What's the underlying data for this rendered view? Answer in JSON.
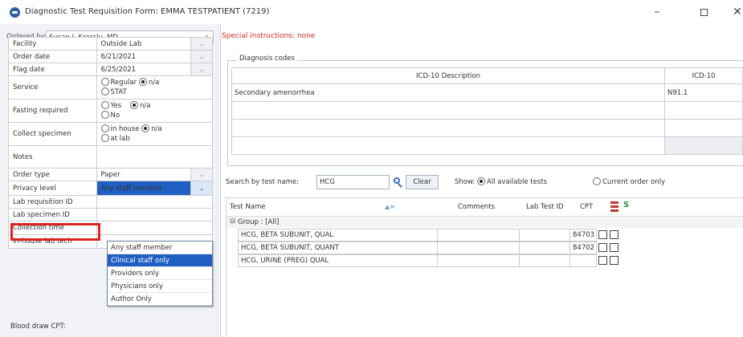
{
  "window": {
    "title": "Diagnostic Test Requisition Form: EMMA TESTPATIENT (7219)",
    "minimize": "–",
    "close": "✕"
  },
  "ordered_by": {
    "label": "Ordered by:",
    "value": "Susan J. Kressly, MD"
  },
  "fields": {
    "facility": {
      "label": "Facility",
      "value": "Outside Lab"
    },
    "order_date": {
      "label": "Order date",
      "value": "6/21/2021"
    },
    "flag_date": {
      "label": "Flag date",
      "value": "6/25/2021"
    },
    "service": {
      "label": "Service",
      "opt1": "Regular",
      "opt2": "n/a",
      "opt3": "STAT",
      "selected": "n/a"
    },
    "fasting": {
      "label": "Fasting required",
      "opt1": "Yes",
      "opt2": "n/a",
      "opt3": "No",
      "selected": "n/a"
    },
    "collect": {
      "label": "Collect specimen",
      "opt1": "in house",
      "opt2": "n/a",
      "opt3": "at lab",
      "selected": "n/a"
    },
    "notes": {
      "label": "Notes",
      "value": ""
    },
    "order_type": {
      "label": "Order type",
      "value": "Paper"
    },
    "privacy": {
      "label": "Privacy level",
      "value": "Any staff member"
    },
    "lab_req": {
      "label": "Lab requisition ID"
    },
    "lab_spec": {
      "label": "Lab specimen ID"
    },
    "collection_time": {
      "label": "Collection time"
    },
    "inhouse_tech": {
      "label": "In-house lab tech"
    }
  },
  "privacy_options": [
    "Any staff member",
    "Clinical staff only",
    "Providers only",
    "Physicians only",
    "Author Only"
  ],
  "privacy_highlighted": "Clinical staff only",
  "blood_draw_label": "Blood draw CPT:",
  "special_instructions": "Special instructions: none",
  "diagnosis": {
    "group_title": "Diagnosis codes",
    "col_desc": "ICD-10 Description",
    "col_code": "ICD-10",
    "rows": [
      {
        "desc": "Secondary amenorrhea",
        "code": "N91.1"
      },
      {
        "desc": "",
        "code": ""
      },
      {
        "desc": "",
        "code": ""
      },
      {
        "desc": "",
        "code": ""
      }
    ]
  },
  "search": {
    "label": "Search by test name:",
    "value": "HCG",
    "clear": "Clear",
    "show_label": "Show:",
    "show_opt1": "All available tests",
    "show_opt2": "Current order only",
    "selected": "All available tests"
  },
  "tests": {
    "headers": {
      "name": "Test Name",
      "comments": "Comments",
      "lab_test_id": "Lab Test ID",
      "cpt": "CPT",
      "s": "S"
    },
    "group": "Group : [All]",
    "rows": [
      {
        "name": "HCG, BETA SUBUNIT, QUAL",
        "comments": "",
        "lab_id": "",
        "cpt": "84703"
      },
      {
        "name": "HCG, BETA SUBUNIT, QUANT",
        "comments": "",
        "lab_id": "",
        "cpt": "84702"
      },
      {
        "name": "HCG, URINE (PREG) QUAL",
        "comments": "",
        "lab_id": "",
        "cpt": ""
      }
    ]
  }
}
